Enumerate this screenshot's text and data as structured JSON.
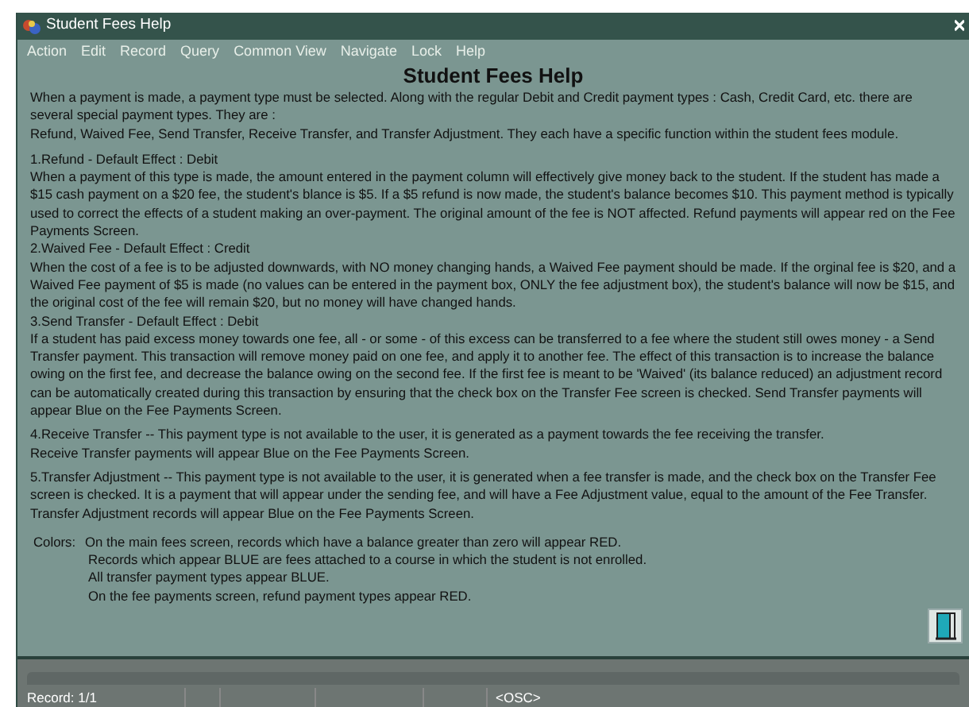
{
  "window": {
    "title": "Student Fees Help"
  },
  "menu": [
    "Action",
    "Edit",
    "Record",
    "Query",
    "Common View",
    "Navigate",
    "Lock",
    "Help"
  ],
  "heading": "Student Fees Help",
  "intro": [
    "When a payment is made, a payment type must be selected.  Along with the regular Debit and Credit payment types : Cash, Credit Card, etc. there are several special payment types. They are :",
    "Refund, Waived Fee, Send Transfer, Receive Transfer, and Transfer Adjustment. They each have a specific function within the student fees module."
  ],
  "sections": [
    {
      "title": "1.Refund - Default Effect : Debit",
      "body": "When a payment of this type is made, the amount entered in the payment column will effectively give money back to the student.  If the student has made a $15 cash payment on a $20 fee, the student's blance is $5.  If a $5 refund is now made, the student's balance becomes $10.  This payment method is typically used to correct the effects of a student making an over-payment.  The original amount of the fee is NOT affected.  Refund payments will appear red on the Fee Payments Screen."
    },
    {
      "title": "2.Waived Fee - Default Effect : Credit",
      "body": "When the cost of a fee is to be adjusted downwards, with NO money changing hands, a Waived Fee payment should be made.  If the orginal fee is $20, and a Waived Fee payment of $5 is made (no values can be entered in the payment box, ONLY the fee adjustment box), the student's balance will now be $15, and the original cost of the fee will remain $20, but no money will have changed hands."
    },
    {
      "title": "3.Send Transfer - Default Effect : Debit",
      "body": "If a student has paid excess money towards one fee, all - or some - of this excess can be transferred to a fee where the student still owes money - a Send Transfer payment.  This transaction will remove money paid on one fee, and apply it to another fee. The effect of this transaction is to increase the balance owing on the first fee, and decrease the balance owing on the second fee.  If the first fee is meant to be 'Waived' (its balance reduced) an adjustment record can be automatically created during this transaction by ensuring that the check box on the Transfer Fee screen is checked.  Send Transfer payments will appear Blue on the Fee Payments Screen."
    },
    {
      "title": "4.Receive Transfer -- This payment type is not available to the user, it is generated as a payment towards the fee receiving the transfer.",
      "body": "Receive Transfer payments will appear Blue on the Fee Payments Screen."
    },
    {
      "title": "5.Transfer Adjustment -- This payment type is not available to the user, it is generated when a fee transfer is made, and the check box on the Transfer Fee screen is checked.  It is a payment that will appear under the sending fee, and will have a Fee Adjustment value, equal to the amount of the Fee Transfer. Transfer Adjustment records will appear Blue on the Fee Payments Screen."
    }
  ],
  "colors": {
    "label": "Colors:",
    "lines": [
      "On the main fees screen, records which have a  balance greater than zero will appear RED.",
      "Records which appear BLUE are fees attached to a course in which the student is not enrolled.",
      "All transfer payment types appear BLUE.",
      "On the fee payments screen, refund payment types appear RED."
    ]
  },
  "status_bar": {
    "record": "Record: 1/1",
    "mode": "<OSC>"
  }
}
